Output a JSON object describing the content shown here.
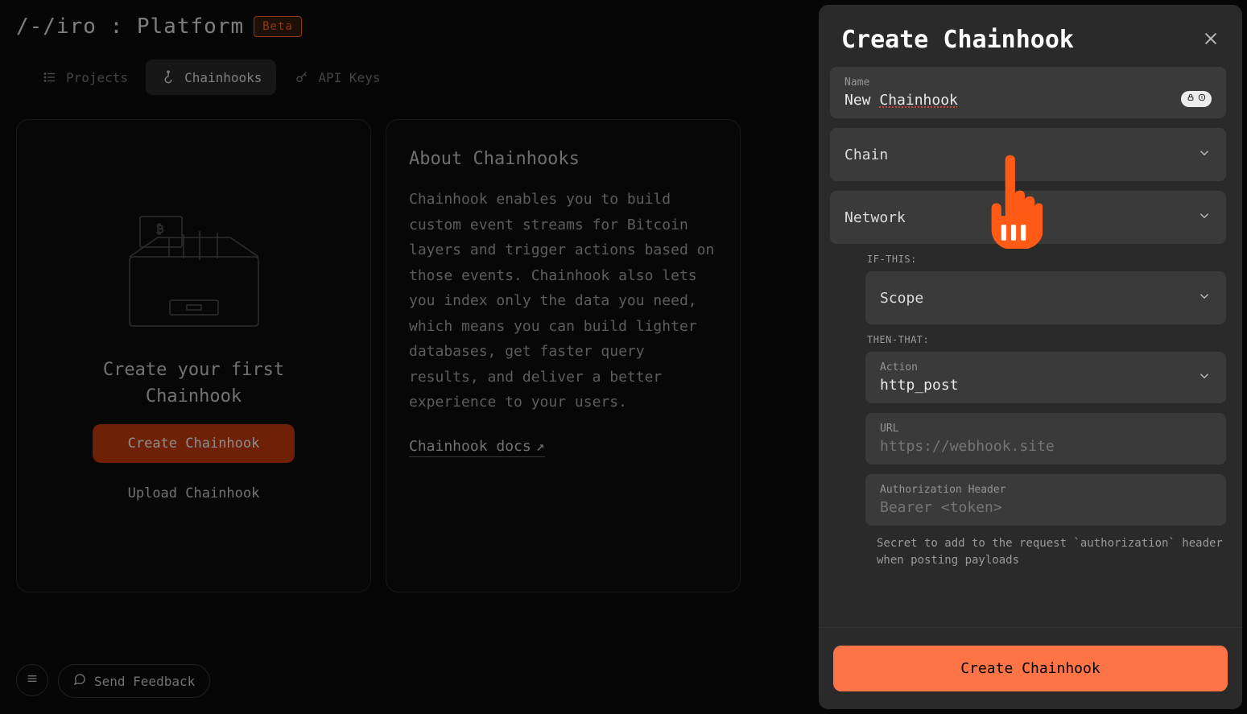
{
  "header": {
    "logo_text": "/-/iro : Platform",
    "beta_label": "Beta"
  },
  "nav": {
    "projects": "Projects",
    "chainhooks": "Chainhooks",
    "api_keys": "API Keys"
  },
  "empty_card": {
    "title_line1": "Create your first",
    "title_line2": "Chainhook",
    "primary_btn": "Create Chainhook",
    "secondary_btn": "Upload Chainhook"
  },
  "about": {
    "heading": "About Chainhooks",
    "body": "Chainhook enables you to build custom event streams for Bitcoin layers and trigger actions based on those events. Chainhook also lets you index only the data you need, which means you can build lighter databases, get faster query results, and deliver a better experience to your users.",
    "link": "Chainhook docs"
  },
  "footer": {
    "feedback": "Send Feedback"
  },
  "panel": {
    "title": "Create Chainhook",
    "name_label": "Name",
    "name_prefix": "New ",
    "name_underlined": "Chainhook",
    "chain_label": "Chain",
    "network_label": "Network",
    "if_this": "IF-THIS:",
    "scope_label": "Scope",
    "then_that": "THEN-THAT:",
    "action_label": "Action",
    "action_value": "http_post",
    "url_label": "URL",
    "url_placeholder": "https://webhook.site",
    "auth_label": "Authorization Header",
    "auth_placeholder": "Bearer <token>",
    "auth_help": "Secret to add to the request `authorization` header when posting payloads",
    "submit": "Create Chainhook"
  }
}
